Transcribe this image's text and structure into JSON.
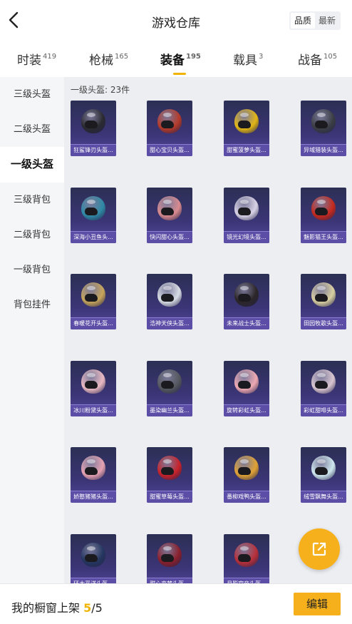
{
  "header": {
    "title": "游戏仓库",
    "sort_options": [
      "品质",
      "最新"
    ],
    "sort_active": 0
  },
  "tabs": [
    {
      "label": "时装",
      "count": "419"
    },
    {
      "label": "枪械",
      "count": "165"
    },
    {
      "label": "装备",
      "count": "195"
    },
    {
      "label": "载具",
      "count": "3"
    },
    {
      "label": "战备",
      "count": "105"
    }
  ],
  "active_tab": 2,
  "sidebar": {
    "items": [
      "三级头盔",
      "二级头盔",
      "一级头盔",
      "三级背包",
      "二级背包",
      "一级背包",
      "背包挂件"
    ],
    "active": 2
  },
  "content": {
    "count_label": "一级头盔: 23件",
    "items": [
      {
        "name": "狂鲨锋刃头盔...",
        "color": "#2a2a30"
      },
      {
        "name": "甜心宝贝头盔...",
        "color": "#b43a2a"
      },
      {
        "name": "甜蜜菠萝头盔...",
        "color": "#e2b615"
      },
      {
        "name": "异域猎装头盔...",
        "color": "#3b3e44"
      },
      {
        "name": "深海小丑鱼头...",
        "color": "#2f8aa6"
      },
      {
        "name": "快闪甜心头盔...",
        "color": "#d98a8e"
      },
      {
        "name": "镜光幻境头盔...",
        "color": "#d8d2e6"
      },
      {
        "name": "魅影猫王头盔...",
        "color": "#c62a1e"
      },
      {
        "name": "春暖花开头盔...",
        "color": "#c7a55a"
      },
      {
        "name": "浩神天侠头盔...",
        "color": "#d8dde4"
      },
      {
        "name": "未来战士头盔...",
        "color": "#2c2628"
      },
      {
        "name": "田园牧歌头盔...",
        "color": "#d9cfa0"
      },
      {
        "name": "冰川粉黛头盔...",
        "color": "#e9b9c2"
      },
      {
        "name": "墨染幽兰头盔...",
        "color": "#55585e"
      },
      {
        "name": "旋转彩虹头盔...",
        "color": "#efa9b2"
      },
      {
        "name": "彩虹甜啡头盔...",
        "color": "#d9c5d0"
      },
      {
        "name": "娇憨猪猪头盔...",
        "color": "#e6a2b2"
      },
      {
        "name": "甜蜜草莓头盔...",
        "color": "#c8222a"
      },
      {
        "name": "番柳戏鸭头盔...",
        "color": "#e0a234"
      },
      {
        "name": "绒雪飘舞头盔...",
        "color": "#cfe8ef"
      },
      {
        "name": "环太平洋头盔...",
        "color": "#243760"
      },
      {
        "name": "甜心恋梦头盔...",
        "color": "#8a1f2c"
      },
      {
        "name": "月影宫帝头盔...",
        "color": "#b8303a"
      }
    ]
  },
  "bottom": {
    "label": "我的橱窗上架",
    "used": "5",
    "total": "/5",
    "edit_label": "编辑"
  },
  "icons": {
    "back": "chevron-left-icon",
    "share": "share-external-icon"
  },
  "colors": {
    "accent": "#f6b01c",
    "card_bg": "#3b3576",
    "card_label": "#5c4ea7"
  }
}
